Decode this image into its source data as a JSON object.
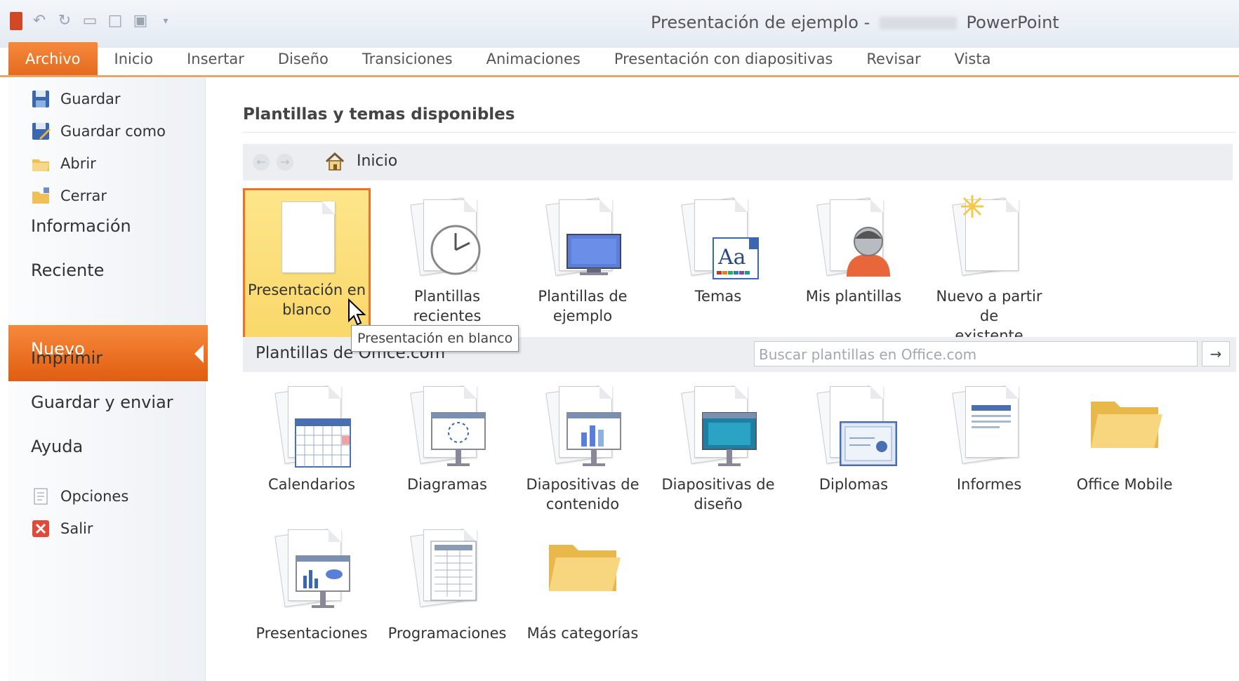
{
  "title": {
    "document": "Presentación de ejemplo",
    "separator": "-",
    "app": "PowerPoint"
  },
  "tabs": [
    "Archivo",
    "Inicio",
    "Insertar",
    "Diseño",
    "Transiciones",
    "Animaciones",
    "Presentación con diapositivas",
    "Revisar",
    "Vista"
  ],
  "nav": {
    "commands_top": [
      "Guardar",
      "Guardar como",
      "Abrir",
      "Cerrar"
    ],
    "items": [
      "Información",
      "Reciente",
      "Nuevo",
      "Imprimir",
      "Guardar y enviar",
      "Ayuda"
    ],
    "commands_bottom": [
      "Opciones",
      "Salir"
    ],
    "selected": "Nuevo"
  },
  "main": {
    "section_title": "Plantillas y temas disponibles",
    "breadcrumb": "Inicio",
    "available": [
      {
        "label": "Presentación en\nblanco",
        "icon": "blank-page-icon",
        "selected": true
      },
      {
        "label": "Plantillas\nrecientes",
        "icon": "clock-icon"
      },
      {
        "label": "Plantillas de\nejemplo",
        "icon": "monitor-icon"
      },
      {
        "label": "Temas",
        "icon": "theme-aa-icon"
      },
      {
        "label": "Mis plantillas",
        "icon": "person-icon"
      },
      {
        "label": "Nuevo a partir de\nexistente",
        "icon": "new-from-existing-icon"
      }
    ],
    "office_title": "Plantillas de Office.com",
    "search_placeholder": "Buscar plantillas en Office.com",
    "office": [
      {
        "label": "Calendarios",
        "icon": "calendar-icon"
      },
      {
        "label": "Diagramas",
        "icon": "diagram-icon"
      },
      {
        "label": "Diapositivas de\ncontenido",
        "icon": "content-slide-icon"
      },
      {
        "label": "Diapositivas de\ndiseño",
        "icon": "design-slide-icon"
      },
      {
        "label": "Diplomas",
        "icon": "diploma-icon"
      },
      {
        "label": "Informes",
        "icon": "report-icon"
      },
      {
        "label": "Office Mobile",
        "icon": "folder-icon"
      },
      {
        "label": "Presentaciones",
        "icon": "presentation-icon"
      },
      {
        "label": "Programaciones",
        "icon": "schedule-icon"
      },
      {
        "label": "Más categorías",
        "icon": "folder-icon"
      }
    ],
    "tooltip": "Presentación en blanco"
  },
  "colors": {
    "accent": "#e86a1f",
    "selection_fill": "#fbdc72",
    "selection_border": "#f0702a"
  }
}
